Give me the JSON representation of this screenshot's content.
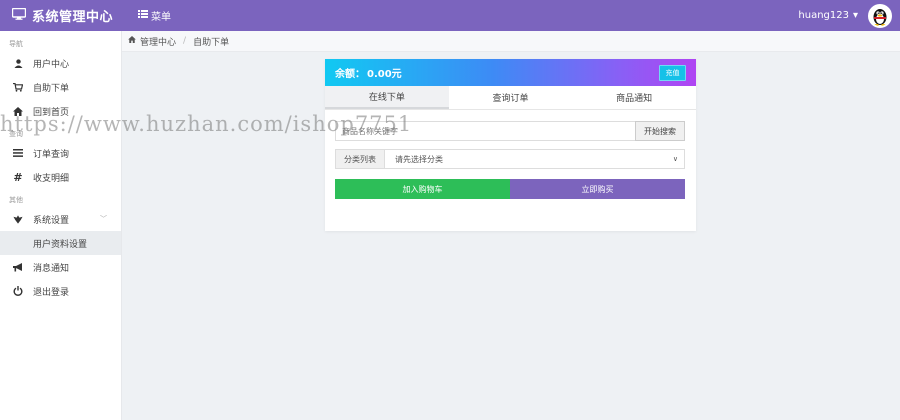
{
  "header": {
    "app_title": "系统管理中心",
    "menu_label": "菜单",
    "username": "huang123",
    "user_caret": "▾",
    "icons": {
      "monitor": "monitor-icon",
      "menu": "menu-icon",
      "avatar": "qq-penguin-avatar"
    },
    "bg_color": "#7b64be"
  },
  "sidebar": {
    "sections": [
      {
        "label": "导航",
        "items": [
          {
            "label": "用户中心",
            "icon": "user-icon"
          },
          {
            "label": "自助下单",
            "icon": "cart-icon"
          },
          {
            "label": "回到首页",
            "icon": "home-icon"
          }
        ]
      },
      {
        "label": "查询",
        "items": [
          {
            "label": "订单查询",
            "icon": "list-icon"
          },
          {
            "label": "收支明细",
            "icon": "hash-icon"
          }
        ]
      },
      {
        "label": "其他",
        "items": [
          {
            "label": "系统设置",
            "icon": "settings-icon",
            "expanded": true,
            "children": [
              {
                "label": "用户资料设置"
              }
            ]
          },
          {
            "label": "消息通知",
            "icon": "bullhorn-icon"
          },
          {
            "label": "退出登录",
            "icon": "power-icon"
          }
        ]
      }
    ]
  },
  "breadcrumb": {
    "home": "管理中心",
    "separator": "/",
    "current": "自助下单"
  },
  "card": {
    "balance_label": "余额：",
    "balance_value": "0.00元",
    "recharge_label": "充值",
    "tabs": [
      {
        "label": "在线下单",
        "active": true
      },
      {
        "label": "查询订单",
        "active": false
      },
      {
        "label": "商品通知",
        "active": false
      }
    ],
    "search": {
      "placeholder": "商品名称关键字",
      "button_label": "开始搜索"
    },
    "category": {
      "label": "分类列表",
      "selected": "请先选择分类"
    },
    "buttons": {
      "add_to_cart": "加入购物车",
      "buy_now": "立即购买"
    },
    "colors": {
      "cart": "#2dbe58",
      "buy": "#7c64bd"
    }
  },
  "watermark": {
    "text": "https://www.huzhan.com/ishop7751"
  }
}
